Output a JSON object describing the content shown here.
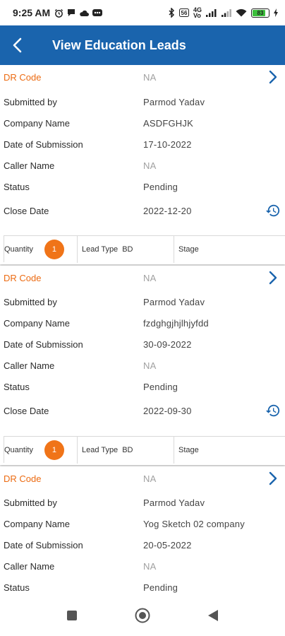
{
  "status_bar": {
    "time": "9:25 AM",
    "signal_text_top": "4G",
    "signal_text_bottom": "Vo",
    "battery": "83"
  },
  "header": {
    "title": "View Education Leads",
    "back_icon": "chevron-left-icon"
  },
  "colors": {
    "appbar": "#1a64ad",
    "accent_orange": "#f07418",
    "icon_blue": "#1a64ad"
  },
  "leads": [
    {
      "dr_code_label": "DR Code",
      "dr_code": "NA",
      "submitted_by_label": "Submitted by",
      "submitted_by": "Parmod Yadav",
      "company_label": "Company Name",
      "company": "ASDFGHJK",
      "date_label": "Date of Submission",
      "date": "17-10-2022",
      "caller_label": "Caller Name",
      "caller": "NA",
      "status_label": "Status",
      "status": "Pending",
      "close_label": "Close Date",
      "close_date": "2022-12-20",
      "quantity_label": "Quantity",
      "quantity": "1",
      "lead_type_label": "Lead Type",
      "lead_type": "BD",
      "stage_label": "Stage"
    },
    {
      "dr_code_label": "DR Code",
      "dr_code": "NA",
      "submitted_by_label": "Submitted by",
      "submitted_by": "Parmod Yadav",
      "company_label": "Company Name",
      "company": "fzdghgjhjlhjyfdd",
      "date_label": "Date of Submission",
      "date": "30-09-2022",
      "caller_label": "Caller Name",
      "caller": "NA",
      "status_label": "Status",
      "status": "Pending",
      "close_label": "Close Date",
      "close_date": "2022-09-30",
      "quantity_label": "Quantity",
      "quantity": "1",
      "lead_type_label": "Lead Type",
      "lead_type": "BD",
      "stage_label": "Stage"
    },
    {
      "dr_code_label": "DR Code",
      "dr_code": "NA",
      "submitted_by_label": "Submitted by",
      "submitted_by": "Parmod Yadav",
      "company_label": "Company Name",
      "company": "Yog Sketch 02 company",
      "date_label": "Date of Submission",
      "date": "20-05-2022",
      "caller_label": "Caller Name",
      "caller": "NA",
      "status_label": "Status",
      "status": "Pending"
    }
  ],
  "nav_bar": {
    "recents_icon": "square-icon",
    "home_icon": "circle-icon",
    "back_icon": "triangle-back-icon"
  }
}
